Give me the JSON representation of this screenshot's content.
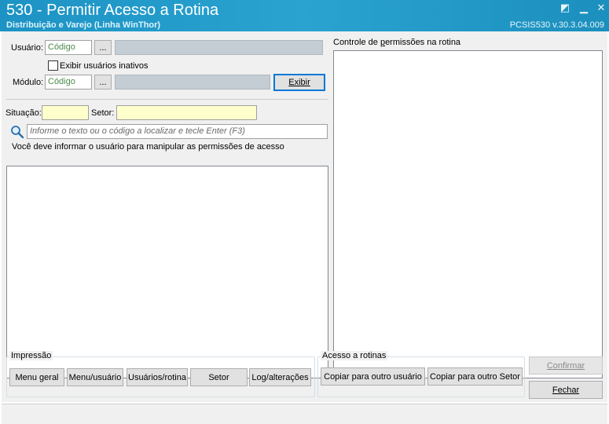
{
  "window": {
    "title": "530 - Permitir Acesso a Rotina",
    "subtitle": "Distribuição e Varejo (Linha WinThor)",
    "version": "PCSIS530  v.30.3.04.009"
  },
  "filters": {
    "usuario_label": "Usuário:",
    "usuario_codigo": "Código",
    "ellipsis": "...",
    "inativos_label": "Exibir usuários inativos",
    "modulo_label": "Módulo:",
    "modulo_codigo": "Código",
    "exibir_label": "Exibir",
    "situacao_label": "Situação:",
    "setor_label": "Setor:",
    "search_placeholder": "Informe o texto ou o código a localizar e tecle Enter (F3)",
    "info_text": "Você deve informar o usuário para manipular as permissões de acesso"
  },
  "right_panel": {
    "title": "Controle de permissões na rotina"
  },
  "impressao": {
    "title": "Impressão",
    "buttons": [
      "Menu geral",
      "Menu/usuário",
      "Usuários/rotina",
      "Setor",
      "Log/alterações"
    ]
  },
  "acesso": {
    "title": "Acesso a rotinas",
    "copy_user": "Copiar para outro usuário",
    "copy_setor": "Copiar para outro Setor"
  },
  "actions": {
    "confirmar": "Confirmar",
    "fechar": "Fechar"
  },
  "colors": {
    "titlebar": "#1c93c4",
    "highlight_input": "#ffffcc",
    "disabled_field": "#c4ccd4"
  }
}
